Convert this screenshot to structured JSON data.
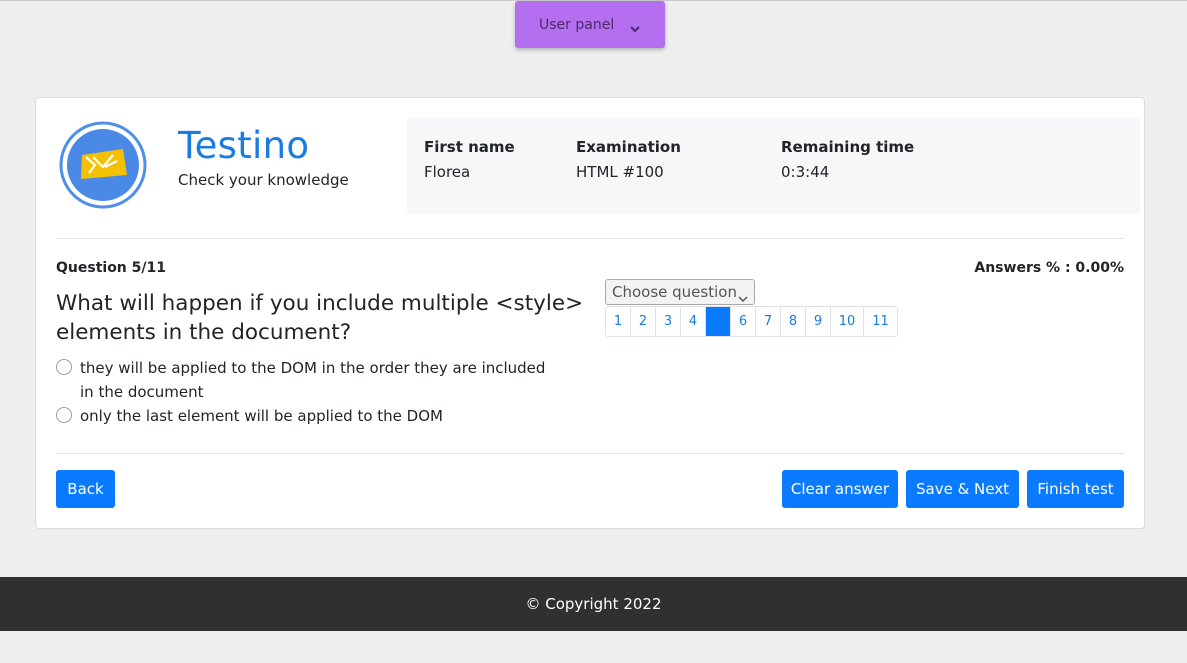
{
  "user_panel": {
    "label": "User panel"
  },
  "brand": {
    "title": "Testino",
    "subtitle": "Check your knowledge"
  },
  "info": {
    "first_name": {
      "label": "First name",
      "value": "Florea"
    },
    "examination": {
      "label": "Examination",
      "value": "HTML #100"
    },
    "remaining_time": {
      "label": "Remaining time",
      "value": "0:3:44"
    }
  },
  "question": {
    "number": "Question 5/11",
    "answers_pct": "Answers % : 0.00%",
    "text": "What will happen if you include multiple <style> elements in the document?",
    "options": [
      "they will be applied to the DOM in the order they are included in the document",
      "only the last element will be applied to the DOM"
    ]
  },
  "navigator": {
    "select_label": "Choose question",
    "pages": [
      "1",
      "2",
      "3",
      "4",
      "5",
      "6",
      "7",
      "8",
      "9",
      "10",
      "11"
    ],
    "active_page": "5"
  },
  "buttons": {
    "back": "Back",
    "clear": "Clear answer",
    "save_next": "Save & Next",
    "finish": "Finish test"
  },
  "footer": {
    "copyright": "© Copyright 2022"
  },
  "colors": {
    "primary": "#0a7bff",
    "user_panel": "#b46ef0",
    "brand": "#1a7be0",
    "footer": "#303030"
  }
}
